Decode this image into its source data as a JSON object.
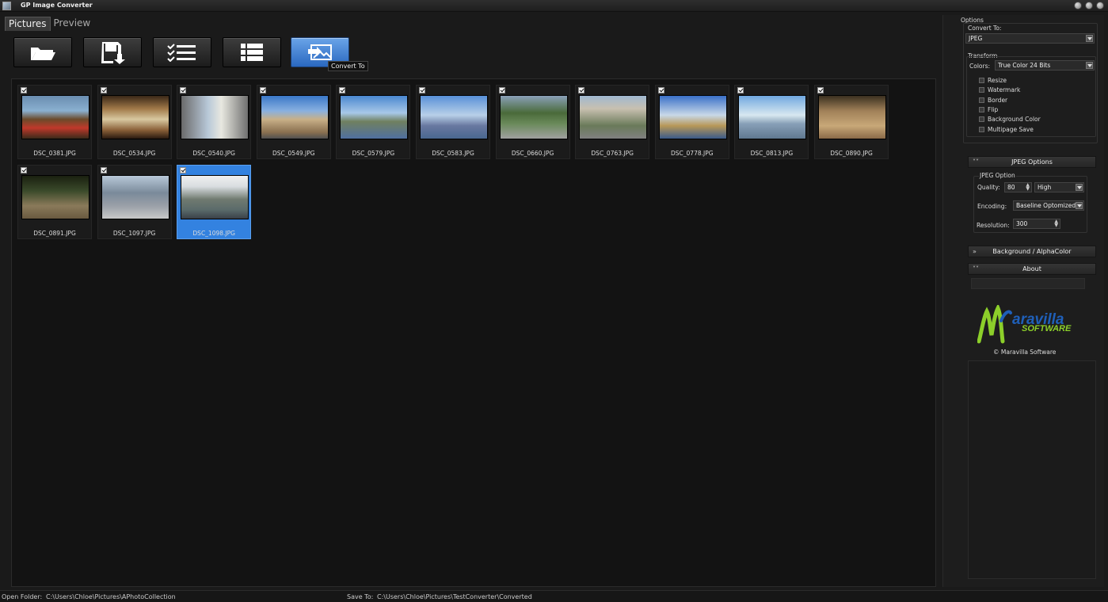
{
  "window": {
    "title": "GP Image Converter"
  },
  "tabs": [
    {
      "label": "Pictures"
    },
    {
      "label": "Preview"
    }
  ],
  "toolbar": {
    "buttons": [
      {
        "icon": "open-folder-icon"
      },
      {
        "icon": "save-icon"
      },
      {
        "icon": "checklist-icon"
      },
      {
        "icon": "list-icon"
      },
      {
        "icon": "convert-icon"
      }
    ],
    "tooltip": "Convert To"
  },
  "images": [
    {
      "name": "DSC_0381.JPG",
      "checked": true
    },
    {
      "name": "DSC_0534.JPG",
      "checked": true
    },
    {
      "name": "DSC_0540.JPG",
      "checked": true
    },
    {
      "name": "DSC_0549.JPG",
      "checked": true
    },
    {
      "name": "DSC_0579.JPG",
      "checked": true
    },
    {
      "name": "DSC_0583.JPG",
      "checked": true
    },
    {
      "name": "DSC_0660.JPG",
      "checked": true
    },
    {
      "name": "DSC_0763.JPG",
      "checked": true
    },
    {
      "name": "DSC_0778.JPG",
      "checked": true
    },
    {
      "name": "DSC_0813.JPG",
      "checked": true
    },
    {
      "name": "DSC_0890.JPG",
      "checked": true
    },
    {
      "name": "DSC_0891.JPG",
      "checked": true
    },
    {
      "name": "DSC_1097.JPG",
      "checked": true
    },
    {
      "name": "DSC_1098.JPG",
      "checked": true,
      "selected": true
    }
  ],
  "options": {
    "title": "Options",
    "convert_to_label": "Convert To:",
    "convert_to_value": "JPEG",
    "transform_label": "Transform",
    "colors_label": "Colors:",
    "colors_value": "True Color 24 Bits",
    "checkboxes": [
      {
        "label": "Resize",
        "checked": false
      },
      {
        "label": "Watermark",
        "checked": false
      },
      {
        "label": "Border",
        "checked": false
      },
      {
        "label": "Flip",
        "checked": false
      },
      {
        "label": "Background Color",
        "checked": false
      },
      {
        "label": "Multipage Save",
        "checked": false
      }
    ]
  },
  "jpeg_options": {
    "header": "JPEG Options",
    "group_label": "JPEG Option",
    "quality_label": "Quality:",
    "quality_value": "80",
    "quality_preset": "High",
    "encoding_label": "Encoding:",
    "encoding_value": "Baseline Optomized",
    "resolution_label": "Resolution:",
    "resolution_value": "300"
  },
  "background_section": {
    "header": "Background / AlphaColor"
  },
  "about_section": {
    "header": "About",
    "logo_word": "aravilla",
    "logo_sub": "SOFTWARE",
    "copyright": "© Maravilla Software"
  },
  "status": {
    "open_folder_label": "Open Folder:",
    "open_folder_path": "C:\\Users\\Chloe\\Pictures\\APhotoCollection",
    "save_to_label": "Save To:",
    "save_to_path": "C:\\Users\\Chloe\\Pictures\\TestConverter\\Converted"
  },
  "colors": {
    "accent": "#3382e0",
    "background": "#131313",
    "logo_green": "#8ccf2a",
    "logo_blue": "#1f5fb8"
  }
}
